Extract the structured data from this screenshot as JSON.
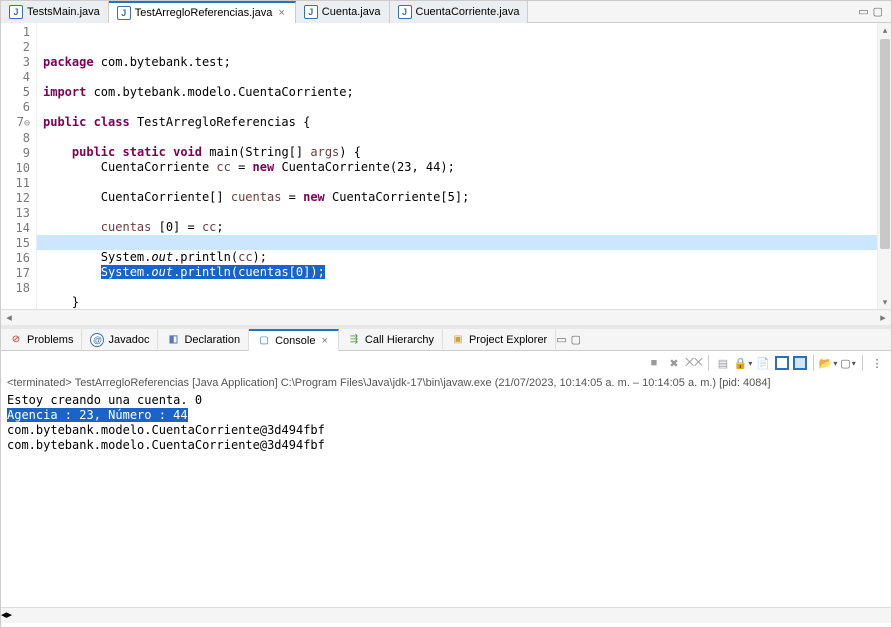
{
  "editor": {
    "tabs": [
      {
        "label": "TestsMain.java",
        "active": false
      },
      {
        "label": "TestArregloReferencias.java",
        "active": true
      },
      {
        "label": "Cuenta.java",
        "active": false
      },
      {
        "label": "CuentaCorriente.java",
        "active": false
      }
    ],
    "lines": {
      "n1": "1",
      "n2": "2",
      "n3": "3",
      "n4": "4",
      "n5": "5",
      "n6": "6",
      "n7": "7",
      "fold7": "⊖",
      "n8": "8",
      "n9": "9",
      "n10": "10",
      "n11": "11",
      "n12": "12",
      "n13": "13",
      "n14": "14",
      "n15": "15",
      "n16": "16",
      "n17": "17",
      "n18": "18"
    },
    "code": {
      "l1_kw": "package",
      "l1_rest": " com.bytebank.test;",
      "l3_kw": "import",
      "l3_rest": " com.bytebank.modelo.CuentaCorriente;",
      "l5_kw1": "public",
      "l5_kw2": "class",
      "l5_name": " TestArregloReferencias ",
      "l5_brace": "{",
      "l7_kw1": "public",
      "l7_kw2": "static",
      "l7_kw3": "void",
      "l7_name": " main(String[] ",
      "l7_arg": "args",
      "l7_end": ") {",
      "l8_a": "CuentaCorriente ",
      "l8_var": "cc",
      "l8_b": " = ",
      "l8_kw": "new",
      "l8_c": " CuentaCorriente(23, 44);",
      "l10_a": "CuentaCorriente[] ",
      "l10_var": "cuentas",
      "l10_b": " = ",
      "l10_kw": "new",
      "l10_c": " CuentaCorriente[5];",
      "l12_var": "cuentas",
      "l12_b": " [0] = ",
      "l12_var2": "cc",
      "l12_c": ";",
      "l14_a": "System.",
      "l14_out": "out",
      "l14_b": ".println(",
      "l14_var": "cc",
      "l14_c": ");",
      "l15_a": "System.",
      "l15_out": "out",
      "l15_b": ".println(",
      "l15_var": "cuentas",
      "l15_c": "[0]);",
      "l17": "}"
    }
  },
  "views": {
    "tabs": [
      {
        "label": "Problems"
      },
      {
        "label": "Javadoc"
      },
      {
        "label": "Declaration"
      },
      {
        "label": "Console",
        "active": true
      },
      {
        "label": "Call Hierarchy"
      },
      {
        "label": "Project Explorer"
      }
    ]
  },
  "console": {
    "header_prefix": "<terminated> ",
    "header_main": "TestArregloReferencias [Java Application] C:\\Program Files\\Java\\jdk-17\\bin\\javaw.exe  (21/07/2023, 10:14:05 a. m. – 10:14:05 a. m.) [pid: 4084]",
    "out1": "Estoy creando una cuenta. 0",
    "out2": "Agencia : 23, Número : 44",
    "out3": "com.bytebank.modelo.CuentaCorriente@3d494fbf",
    "out4": "com.bytebank.modelo.CuentaCorriente@3d494fbf"
  }
}
